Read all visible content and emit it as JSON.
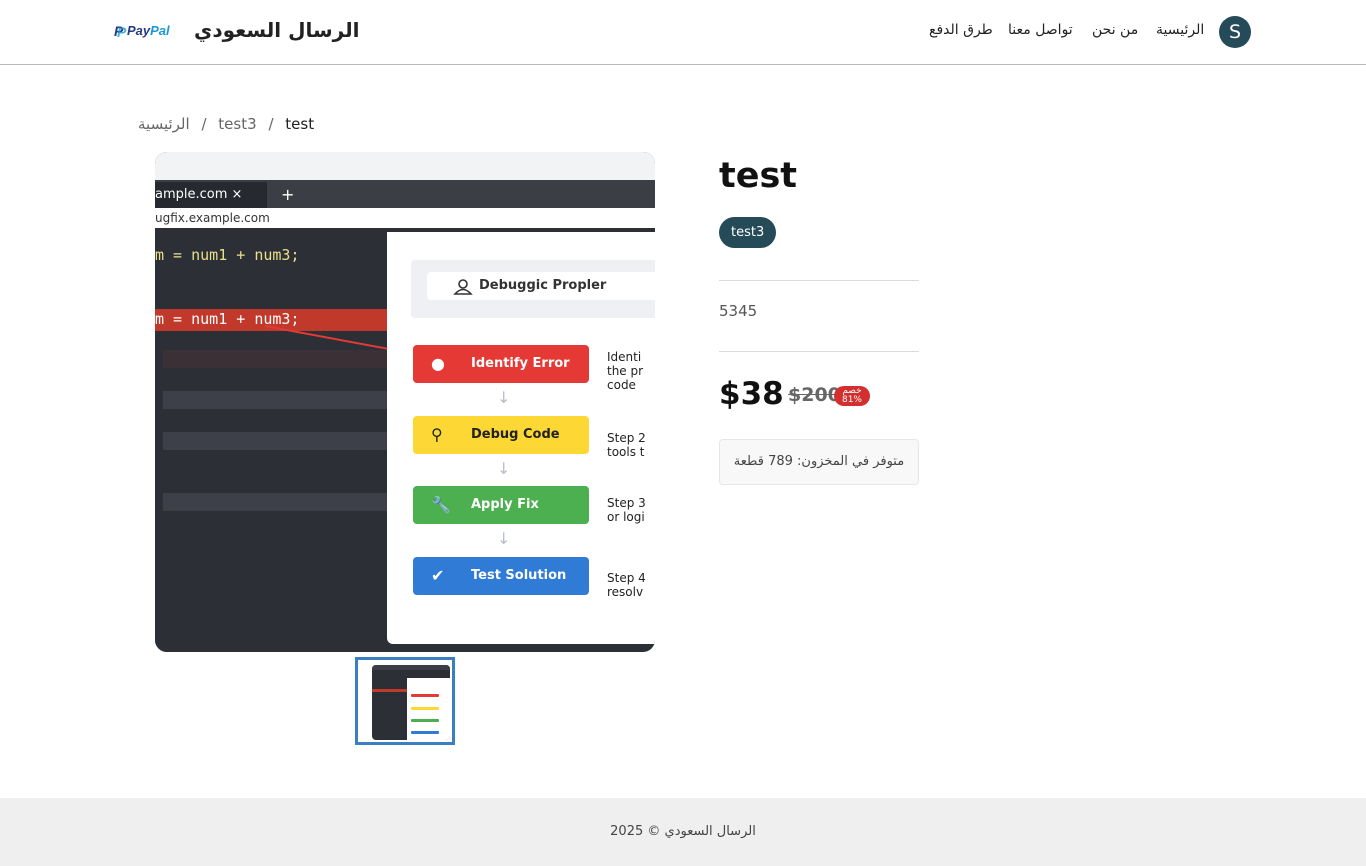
{
  "header": {
    "avatar_letter": "S",
    "nav": [
      "الرئيسية",
      "من نحن",
      "تواصل معنا",
      "طرق الدفع"
    ],
    "brand": "الرسال السعودي",
    "paypal_mark": "P",
    "paypal_text_1": "Pay",
    "paypal_text_2": "Pal"
  },
  "breadcrumb": {
    "home": "الرئيسية",
    "separator": "/",
    "category": "test3",
    "current": "test"
  },
  "product_image": {
    "tab_label": "ample.com  ×",
    "tab_plus": "+",
    "url_text": "ugfix.example.com",
    "code_line_1": "m = num1 + num3;",
    "code_line_2": "m = num1 + num3;",
    "panel_button": "Debuggic Propler",
    "steps": [
      {
        "label": "Identify Error",
        "icon": "users-icon",
        "color": "#e53935",
        "note": "Identi\nthe pr\ncode"
      },
      {
        "label": "Debug Code",
        "icon": "search-icon",
        "color": "#fdd835",
        "note": "Step 2\ntools t"
      },
      {
        "label": "Apply Fix",
        "icon": "wrench-icon",
        "color": "#4caf50",
        "note": "Step 3\nor logi"
      },
      {
        "label": "Test Solution",
        "icon": "check-circle-icon",
        "color": "#2f7bd6",
        "note": "Step 4\nresolv"
      }
    ]
  },
  "product": {
    "title": "test",
    "category_badge": "test3",
    "sku": "5345",
    "price": "$38",
    "old_price": "$200",
    "discount_line_1": "خصم",
    "discount_line_2": "81%",
    "stock": "متوفر في المخزون: 789 قطعة"
  },
  "footer": {
    "text": "الرسال السعودي © 2025"
  },
  "colors": {
    "accent": "#254a58",
    "discount": "#d32f2f",
    "thumb_border": "#3a7fc2"
  }
}
